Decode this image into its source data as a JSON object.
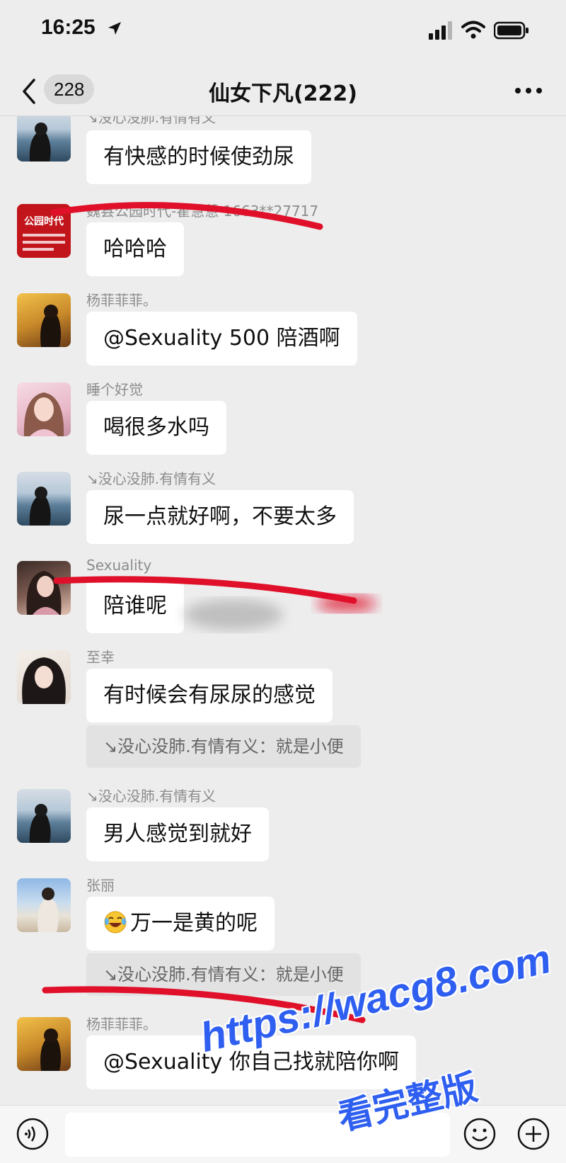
{
  "status": {
    "time": "16:25"
  },
  "nav": {
    "badge": "228",
    "title": "仙女下凡(222)"
  },
  "messages": [
    {
      "sender": "↘没心没肺.有情有义",
      "text": "有快感的时候使劲尿"
    },
    {
      "sender": "魏县公园时代-翟慧慧 1663**27717",
      "text": "哈哈哈",
      "avatar_text": "公园时代"
    },
    {
      "sender": "杨菲菲菲。",
      "text": "@Sexuality 500 陪酒啊"
    },
    {
      "sender": "睡个好觉",
      "text": "喝很多水吗"
    },
    {
      "sender": "↘没心没肺.有情有义",
      "text": "尿一点就好啊，不要太多"
    },
    {
      "sender": "Sexuality",
      "text": "陪谁呢"
    },
    {
      "sender": "至幸",
      "text": "有时候会有尿尿的感觉",
      "quote": "↘没心没肺.有情有义：就是小便"
    },
    {
      "sender": "↘没心没肺.有情有义",
      "text": "男人感觉到就好"
    },
    {
      "sender": "张丽",
      "text": "万一是黄的呢",
      "emoji": "laughing-tears",
      "quote": "↘没心没肺.有情有义：就是小便"
    },
    {
      "sender": "杨菲菲菲。",
      "text": "@Sexuality 你自己找就陪你啊"
    }
  ],
  "watermark": {
    "url": "https://wacg8.com",
    "caption": "看完整版"
  },
  "colors": {
    "background": "#ededed",
    "bubble": "#ffffff",
    "markup_red": "#e0102a",
    "watermark_blue": "#2f5ff0"
  }
}
